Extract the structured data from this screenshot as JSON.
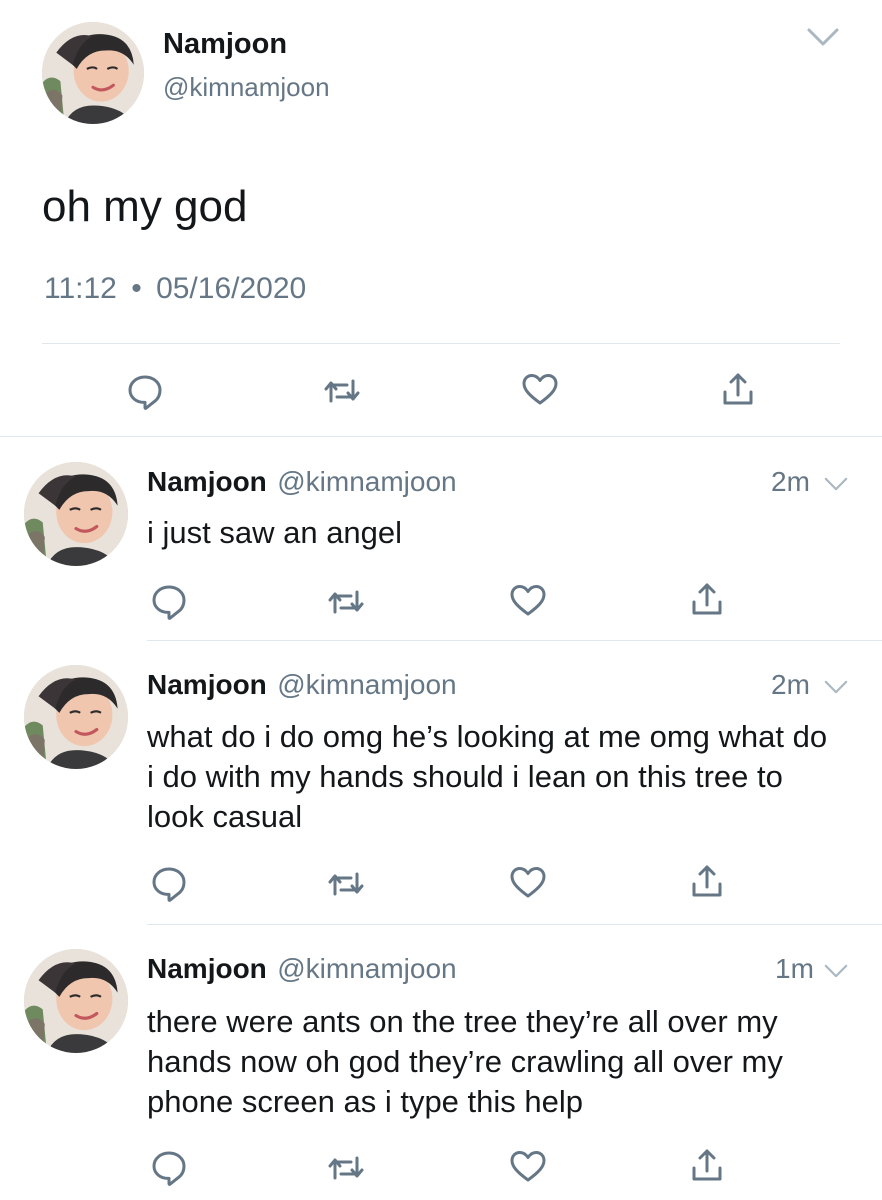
{
  "tweet": {
    "author_name": "Namjoon",
    "handle": "@kimnamjoon",
    "text": "oh my god",
    "time": "11:12",
    "separator": "•",
    "date": "05/16/2020"
  },
  "replies": [
    {
      "author_name": "Namjoon",
      "handle": "@kimnamjoon",
      "time_ago": "2m",
      "text": "i just saw an angel"
    },
    {
      "author_name": "Namjoon",
      "handle": "@kimnamjoon",
      "time_ago": "2m",
      "text": "what do i do omg he’s looking at me omg what do i do with my hands should i lean on this tree to look casual"
    },
    {
      "author_name": "Namjoon",
      "handle": "@kimnamjoon",
      "time_ago": "1m",
      "text": "there were ants on the tree they’re all over my hands now oh god they’re crawling all over my phone screen as i type this help"
    }
  ],
  "icons": {
    "reply": "reply-icon",
    "retweet": "retweet-icon",
    "like": "like-icon",
    "share": "share-icon",
    "caret": "chevron-down-icon"
  },
  "colors": {
    "icon_gray": "#657786",
    "text": "#14171a",
    "divider": "#e1e8ed"
  }
}
